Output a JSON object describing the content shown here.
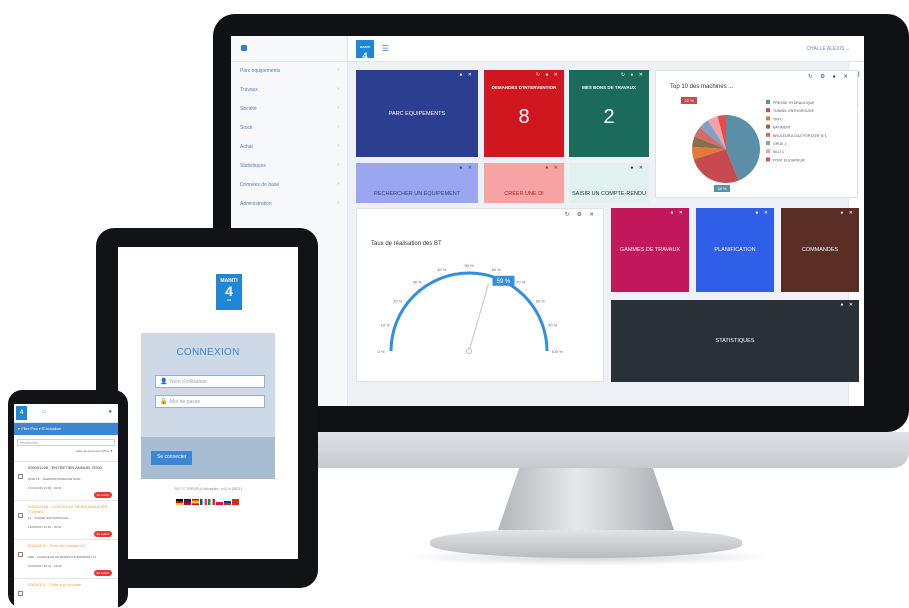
{
  "colors": {
    "accent": "#1e87d8",
    "sidebar_link": "#5b7db3",
    "red": "#e53935"
  },
  "desktop": {
    "logo": {
      "line1": "MAINTI",
      "line2": "4"
    },
    "user_name": "CHALLE ALEXIS",
    "sidebar_items": [
      {
        "label": "Parc équipements",
        "icon": "chevron-right-icon"
      },
      {
        "label": "Travaux",
        "icon": "chevron-right-icon"
      },
      {
        "label": "Société",
        "icon": "chevron-right-icon"
      },
      {
        "label": "Stock",
        "icon": "chevron-right-icon"
      },
      {
        "label": "Achat",
        "icon": "chevron-right-icon"
      },
      {
        "label": "Statistiques",
        "icon": "chevron-right-icon"
      },
      {
        "label": "Données de base",
        "icon": "chevron-right-icon"
      },
      {
        "label": "Administration",
        "icon": "chevron-right-icon"
      }
    ],
    "tiles": {
      "parc": "PARC EQUIPEMENTS",
      "demandes_title": "DEMANDES D'INTERVENTION",
      "demandes_value": "8",
      "bons_title": "MES BONS DE TRAVAUX",
      "bons_value": "2",
      "rechercher": "RECHERCHER UN ÉQUIPEMENT",
      "creer": "CRÉER UNE DI",
      "saisir": "SAISIR UN COMPTE-RENDU",
      "gammes": "GAMMES DE TRAVAUX",
      "planification": "PLANIFICATION",
      "commandes": "COMMANDES",
      "statistiques": "STATISTIQUES"
    },
    "pie": {
      "title": "Top 10 des machines ...",
      "legend": [
        "PRESSE HYDRAULIQUE",
        "TUNNEL ENTHOROUGE",
        "TRFC",
        "BATIMENT",
        "BRULEUR A GAZ PORTATIF N°1",
        "GRUE 1",
        "KILD 1",
        "PONT ELEVATEUR"
      ],
      "legend_colors": [
        "#5b8fa8",
        "#c64a4f",
        "#e07b39",
        "#8a6d4b",
        "#d36b6b",
        "#7fa0c8",
        "#f0a3a8",
        "#e44d4d"
      ],
      "callout_top": "22 %",
      "callout_bottom": "38 %"
    },
    "gauge": {
      "title": "Taux de réalisation des BT",
      "value": 59,
      "value_label": "59 %",
      "ticks": [
        "0 %",
        "10 %",
        "20 %",
        "30 %",
        "40 %",
        "50 %",
        "60 %",
        "70 %",
        "80 %",
        "90 %",
        "100 %"
      ]
    }
  },
  "tablet": {
    "logo": {
      "line1": "MAINTI",
      "line2": "4",
      "line3": "4.0"
    },
    "login_title": "CONNEXION",
    "username_placeholder": "Nom d'utilisateur",
    "password_placeholder": "Mot de passe",
    "submit_label": "Se connecter",
    "copyright": "2017 © TRESPLA Industries - v4.2.6 (5831)"
  },
  "phone": {
    "filter_bar": "▼ Filtre   Plan ▾   ☰ Actualiser",
    "search_placeholder": "Rechercher",
    "sort_label": "Date de lancement (Plus ▼",
    "rows": [
      {
        "title": "000001208 - ENTRETIEN ANNUEL R200",
        "desc": "R200 FF - THERMOFORMEUSE R200",
        "date": "17/11/2016 13:06 - 09:00",
        "badge": "En retard",
        "orange": false
      },
      {
        "title": "000002018 - CONTROLE HEBDOMADAIRE TUNNEL",
        "desc": "T1 - TUNNEL ENTHOROUGE",
        "date": "12/06/2017 11:15 - 06:00",
        "badge": "En retard",
        "orange": true
      },
      {
        "title": "00004209 - Prise sur chargeur d…",
        "desc": "CBD - CHARGEUR DE BARRATTE BARRATE N°1",
        "date": "21/06/2017 10:14 - 06:00",
        "badge": "En retard",
        "orange": true
      },
      {
        "title": "00004321 - Fuite sur conduite",
        "desc": "",
        "date": "",
        "badge": "",
        "orange": true
      }
    ]
  }
}
